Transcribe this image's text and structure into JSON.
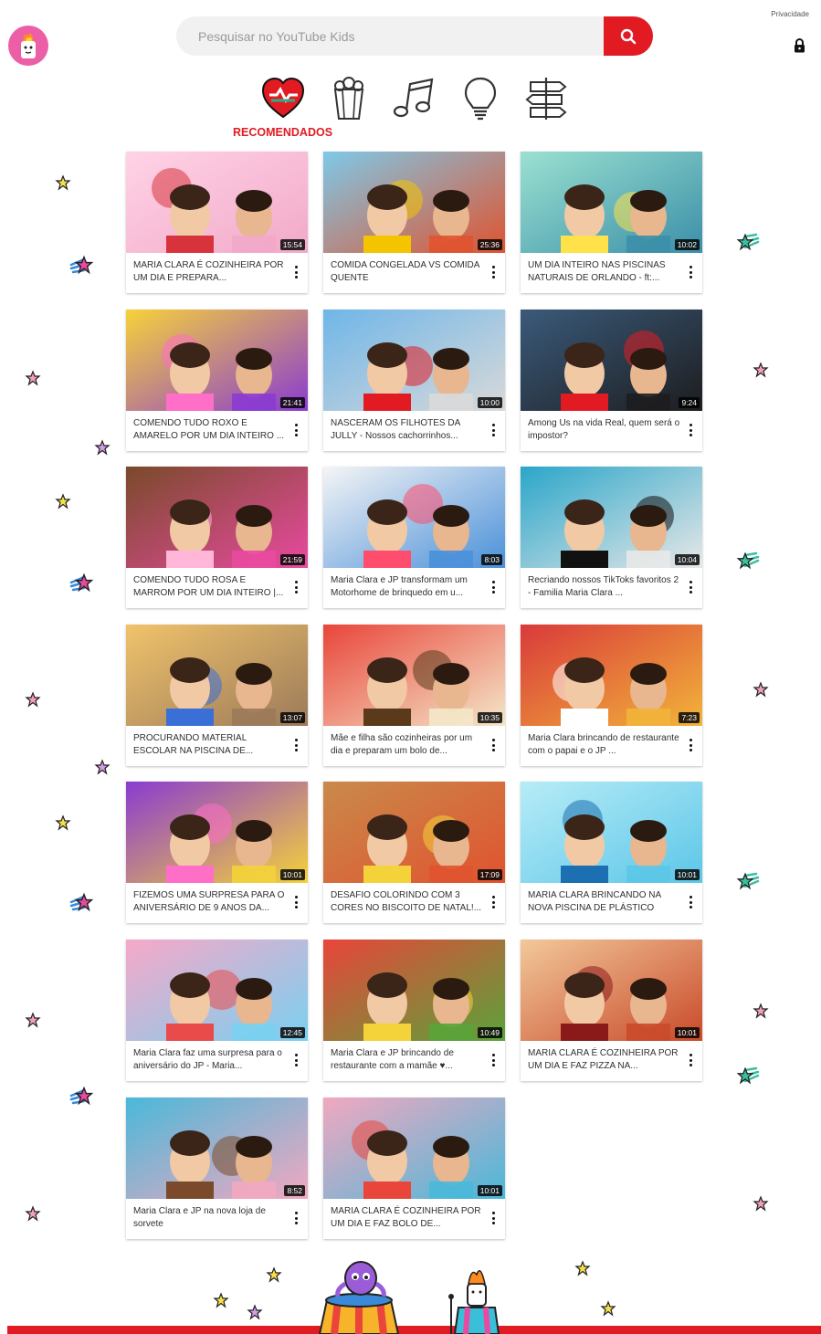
{
  "header": {
    "search_placeholder": "Pesquisar no YouTube Kids",
    "privacy_label": "Privacidade"
  },
  "categories": {
    "active_label": "RECOMENDADOS",
    "items": [
      {
        "name": "recommended",
        "icon": "heart-icon",
        "active": true
      },
      {
        "name": "shows",
        "icon": "popcorn-icon",
        "active": false
      },
      {
        "name": "music",
        "icon": "music-note-icon",
        "active": false
      },
      {
        "name": "learning",
        "icon": "lightbulb-icon",
        "active": false
      },
      {
        "name": "explore",
        "icon": "signpost-icon",
        "active": false
      }
    ]
  },
  "colors": {
    "accent": "#e21b23",
    "avatar": "#ec5fa6"
  },
  "videos": [
    {
      "title": "MARIA CLARA É COZINHEIRA POR UM DIA E PREPARA...",
      "duration": "15:54",
      "bg": "#f2a9c9",
      "bg2": "#ffd3e6",
      "accent": "#d8333c"
    },
    {
      "title": "COMIDA CONGELADA VS COMIDA QUENTE",
      "duration": "25:36",
      "bg": "#e0532f",
      "bg2": "#7ec9e8",
      "accent": "#f4c400"
    },
    {
      "title": "UM DIA INTEIRO NAS PISCINAS NATURAIS DE ORLANDO - ft:...",
      "duration": "10:02",
      "bg": "#3b8fa8",
      "bg2": "#9be1d1",
      "accent": "#ffe14a"
    },
    {
      "title": "COMENDO TUDO ROXO E AMARELO POR UM DIA INTEIRO ...",
      "duration": "21:41",
      "bg": "#8a3bd1",
      "bg2": "#f6d23a",
      "accent": "#ff6ec7"
    },
    {
      "title": "NASCERAM OS FILHOTES DA JULLY - Nossos cachorrinhos...",
      "duration": "10:00",
      "bg": "#d9d9d9",
      "bg2": "#6fb6e8",
      "accent": "#e21b23"
    },
    {
      "title": "Among Us na vida Real, quem será o impostor?",
      "duration": "9:24",
      "bg": "#1d1d1f",
      "bg2": "#3a5a7a",
      "accent": "#e21b23"
    },
    {
      "title": "COMENDO TUDO ROSA E MARROM POR UM DIA INTEIRO |...",
      "duration": "21:59",
      "bg": "#e94aa0",
      "bg2": "#7a4a2a",
      "accent": "#ffb6d9"
    },
    {
      "title": "Maria Clara e JP transformam um Motorhome de brinquedo em u...",
      "duration": "8:03",
      "bg": "#4a90d9",
      "bg2": "#f5f5f5",
      "accent": "#ff4d6d"
    },
    {
      "title": "Recriando nossos TikToks favoritos 2 - Familia Maria Clara ...",
      "duration": "10:04",
      "bg": "#e8e8e8",
      "bg2": "#2aa6c9",
      "accent": "#111111"
    },
    {
      "title": "PROCURANDO MATERIAL ESCOLAR NA PISCINA DE...",
      "duration": "13:07",
      "bg": "#9b7a5a",
      "bg2": "#f0c36b",
      "accent": "#3a6fd8"
    },
    {
      "title": "Mãe e filha são cozinheiras por um dia e preparam um bolo de...",
      "duration": "10:35",
      "bg": "#f4e7c9",
      "bg2": "#e9453a",
      "accent": "#5a3a1a"
    },
    {
      "title": "Maria Clara brincando de restaurante com o papai e o JP ...",
      "duration": "7:23",
      "bg": "#f2b43a",
      "bg2": "#d93a3a",
      "accent": "#ffffff"
    },
    {
      "title": "FIZEMOS UMA SURPRESA PARA O ANIVERSÁRIO DE 9 ANOS DA...",
      "duration": "10:01",
      "bg": "#f4d23a",
      "bg2": "#8a3bd1",
      "accent": "#ff6ec7"
    },
    {
      "title": "DESAFIO COLORINDO COM 3 CORES NO BISCOITO DE NATAL!...",
      "duration": "17:09",
      "bg": "#e0532f",
      "bg2": "#c98a4a",
      "accent": "#f4d23a"
    },
    {
      "title": "MARIA CLARA BRINCANDO NA NOVA PISCINA DE PLÁSTICO",
      "duration": "10:01",
      "bg": "#5cc6e8",
      "bg2": "#b7ecf7",
      "accent": "#1c6fb0"
    },
    {
      "title": "Maria Clara faz uma surpresa para o aniversário do JP - Maria...",
      "duration": "12:45",
      "bg": "#7ad0f0",
      "bg2": "#f7a8c8",
      "accent": "#e94a4a"
    },
    {
      "title": "Maria Clara e JP brincando de restaurante com a mamãe ♥...",
      "duration": "10:49",
      "bg": "#5aa33a",
      "bg2": "#e9453a",
      "accent": "#f4d23a"
    },
    {
      "title": "MARIA CLARA É COZINHEIRA POR UM DIA E FAZ PIZZA NA...",
      "duration": "10:01",
      "bg": "#c94a2a",
      "bg2": "#f2c89a",
      "accent": "#8a1a1a"
    },
    {
      "title": "Maria Clara e JP na nova loja de sorvete",
      "duration": "8:52",
      "bg": "#f2a8c0",
      "bg2": "#4ab8d9",
      "accent": "#7a4a2a"
    },
    {
      "title": "MARIA CLARA É COZINHEIRA POR UM DIA E FAZ BOLO DE...",
      "duration": "10:01",
      "bg": "#4ab8d9",
      "bg2": "#f2a8c0",
      "accent": "#e9453a"
    }
  ]
}
